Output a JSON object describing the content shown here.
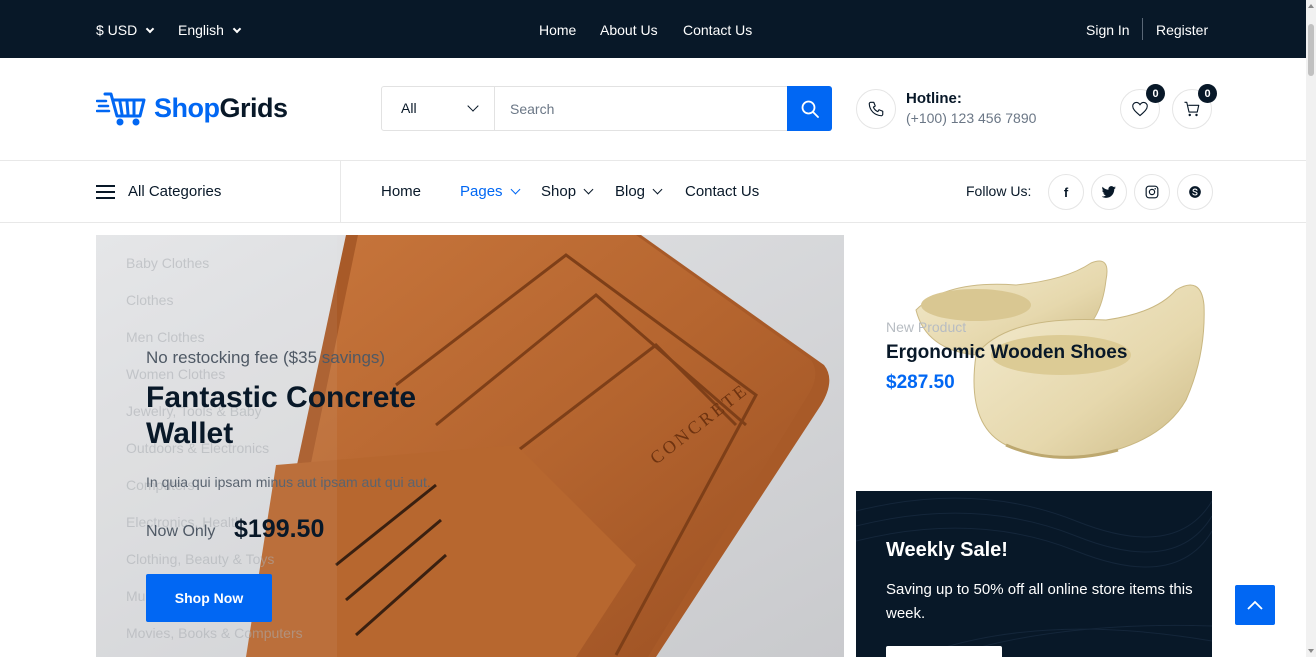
{
  "topbar": {
    "currency": "$ USD",
    "language": "English",
    "links": [
      "Home",
      "About Us",
      "Contact Us"
    ],
    "sign_in": "Sign In",
    "register": "Register"
  },
  "header": {
    "logo": {
      "part1": "Shop",
      "part2": "Grids"
    },
    "search": {
      "category": "All",
      "placeholder": "Search"
    },
    "hotline": {
      "title": "Hotline:",
      "number": "(+100) 123 456 7890"
    },
    "wishlist_count": "0",
    "cart_count": "0"
  },
  "nav": {
    "all_categories": "All Categories",
    "links": [
      {
        "label": "Home"
      },
      {
        "label": "Pages"
      },
      {
        "label": "Shop"
      },
      {
        "label": "Blog"
      },
      {
        "label": "Contact Us"
      }
    ],
    "follow_us": "Follow Us:",
    "social": [
      "facebook-icon",
      "twitter-icon",
      "instagram-icon",
      "skype-icon"
    ]
  },
  "category_menu": [
    "Baby Clothes",
    "Clothes",
    "Men Clothes",
    "Women Clothes",
    "Jewelry, Tools & Baby",
    "Outdoors & Electronics",
    "Computers",
    "Electronics, Health",
    "Clothing, Beauty & Toys",
    "Music",
    "Movies, Books & Computers"
  ],
  "hero": {
    "subtitle": "No restocking fee ($35 savings)",
    "title": "Fantastic Concrete Wallet",
    "description": "In quia qui ipsam minus aut ipsam aut qui aut.",
    "now_only": "Now Only",
    "price": "$199.50",
    "button": "Shop Now",
    "wallet_stamp": "CONCRETE"
  },
  "banner_product": {
    "tag": "New Product",
    "name": "Ergonomic Wooden Shoes",
    "price": "$287.50"
  },
  "banner_sale": {
    "title": "Weekly Sale!",
    "text": "Saving up to 50% off all online store items this week."
  },
  "colors": {
    "primary": "#0167f3",
    "dark": "#081828"
  }
}
